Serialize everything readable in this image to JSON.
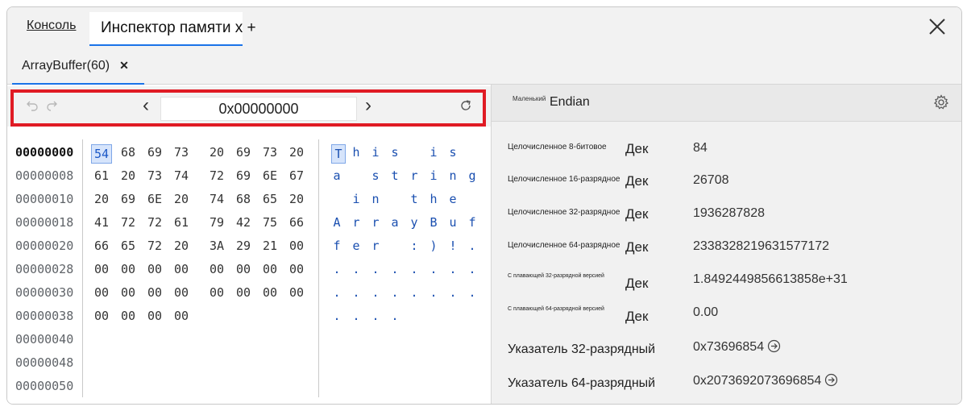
{
  "tabs": {
    "console_label": "Консоль",
    "memory_label": "Инспектор памяти x +"
  },
  "buffer_tab": {
    "label": "ArrayBuffer(60)",
    "close": "✕"
  },
  "nav": {
    "address": "0x00000000",
    "prev": "‹",
    "next": "›"
  },
  "hex_view": {
    "offsets": [
      "00000000",
      "00000008",
      "00000010",
      "00000018",
      "00000020",
      "00000028",
      "00000030",
      "00000038",
      "00000040",
      "00000048",
      "00000050"
    ],
    "rows": [
      {
        "bytes": [
          "54",
          "68",
          "69",
          "73",
          "20",
          "69",
          "73",
          "20"
        ],
        "chars": [
          "T",
          "h",
          "i",
          "s",
          " ",
          "i",
          "s",
          " "
        ]
      },
      {
        "bytes": [
          "61",
          "20",
          "73",
          "74",
          "72",
          "69",
          "6E",
          "67"
        ],
        "chars": [
          "a",
          " ",
          "s",
          "t",
          "r",
          "i",
          "n",
          "g"
        ]
      },
      {
        "bytes": [
          "20",
          "69",
          "6E",
          "20",
          "74",
          "68",
          "65",
          "20"
        ],
        "chars": [
          " ",
          "i",
          "n",
          " ",
          "t",
          "h",
          "e",
          " "
        ]
      },
      {
        "bytes": [
          "41",
          "72",
          "72",
          "61",
          "79",
          "42",
          "75",
          "66"
        ],
        "chars": [
          "A",
          "r",
          "r",
          "a",
          "y",
          "B",
          "u",
          "f"
        ]
      },
      {
        "bytes": [
          "66",
          "65",
          "72",
          "20",
          "3A",
          "29",
          "21",
          "00"
        ],
        "chars": [
          "f",
          "e",
          "r",
          " ",
          ":",
          ")",
          "!",
          "."
        ]
      },
      {
        "bytes": [
          "00",
          "00",
          "00",
          "00",
          "00",
          "00",
          "00",
          "00"
        ],
        "chars": [
          ".",
          ".",
          ".",
          ".",
          ".",
          ".",
          ".",
          "."
        ]
      },
      {
        "bytes": [
          "00",
          "00",
          "00",
          "00",
          "00",
          "00",
          "00",
          "00"
        ],
        "chars": [
          ".",
          ".",
          ".",
          ".",
          ".",
          ".",
          ".",
          "."
        ]
      },
      {
        "bytes": [
          "00",
          "00",
          "00",
          "00"
        ],
        "chars": [
          ".",
          ".",
          ".",
          "."
        ]
      }
    ]
  },
  "inspector": {
    "endian_small": "Маленький",
    "endian_label": "Endian",
    "rows": [
      {
        "label": "Целочисленное 8-битовое",
        "format": "Дек",
        "value": "84"
      },
      {
        "label": "Целочисленное 16-разрядное",
        "format": "Дек",
        "value": "26708"
      },
      {
        "label": "Целочисленное 32-разрядное",
        "format": "Дек",
        "value": "1936287828"
      },
      {
        "label": "Целочисленное 64-разрядное",
        "format": "Дек",
        "value": "2338328219631577172"
      },
      {
        "label": "С плавающей 32-разрядной версией",
        "format": "Дек",
        "value": "1.8492449856613858e+31"
      },
      {
        "label": "С плавающей 64-разрядной версией",
        "format": "Дек",
        "value": "0.00"
      }
    ],
    "pointers": [
      {
        "label": "Указатель 32-разрядный",
        "value": "0x73696854"
      },
      {
        "label": "Указатель 64-разрядный",
        "value": "0x2073692073696854"
      }
    ]
  }
}
